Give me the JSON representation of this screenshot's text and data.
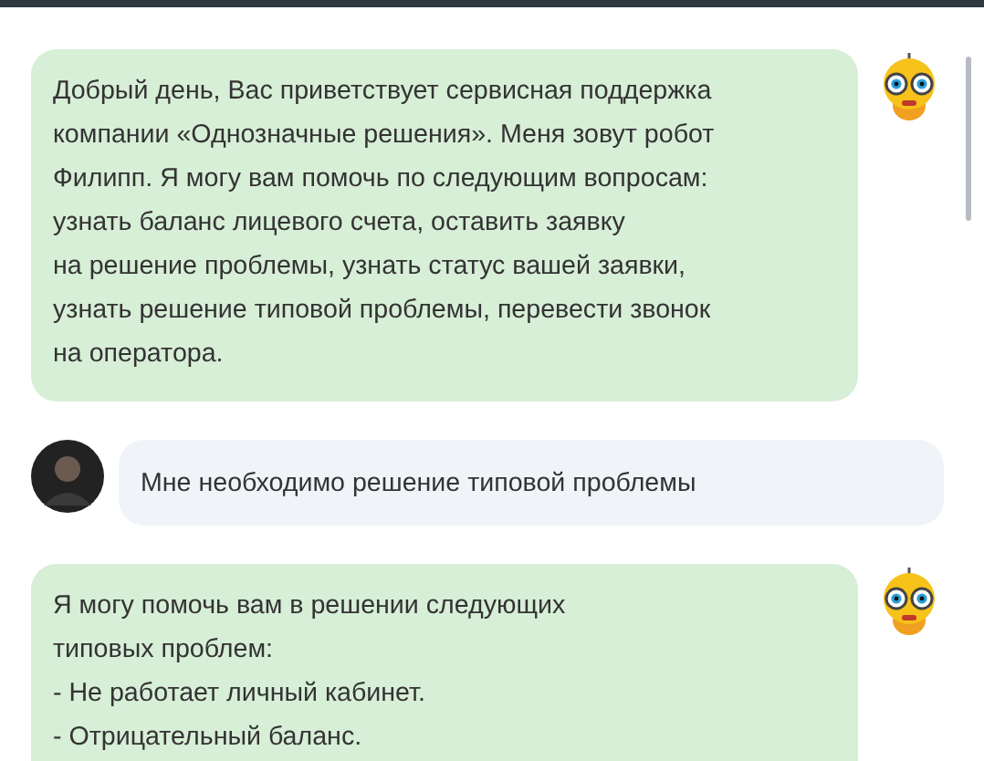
{
  "messages": [
    {
      "kind": "bot",
      "text": "Добрый день, Вас приветствует сервисная поддержка\nкомпании «Однозначные решения». Меня зовут робот\nФилипп. Я могу вам помочь по следующим вопросам:\nузнать баланс лицевого счета, оставить заявку\nна решение проблемы, узнать статус вашей заявки,\nузнать решение типовой проблемы, перевести звонок\nна оператора."
    },
    {
      "kind": "user",
      "text": "Мне необходимо решение типовой проблемы"
    },
    {
      "kind": "bot",
      "text": "Я могу помочь вам в решении следующих\nтиповых проблем:\n- Не работает личный кабинет.\n- Отрицательный баланс."
    }
  ]
}
